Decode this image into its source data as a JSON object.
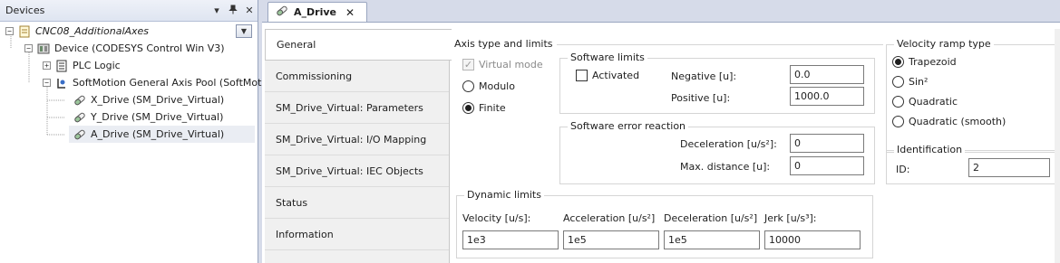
{
  "devices": {
    "title": "Devices",
    "pin_icon": "pin-icon",
    "close_label": "✕",
    "tree": [
      {
        "label": "CNC08_AdditionalAxes",
        "italic": true,
        "icon": "project-icon"
      },
      {
        "label": "Device (CODESYS Control Win V3)",
        "icon": "device-icon"
      },
      {
        "label": "PLC Logic",
        "icon": "plc-logic-icon"
      },
      {
        "label": "SoftMotion General Axis Pool (SoftMotion",
        "icon": "axis-pool-icon"
      },
      {
        "label": "X_Drive (SM_Drive_Virtual)",
        "icon": "drive-icon"
      },
      {
        "label": "Y_Drive (SM_Drive_Virtual)",
        "icon": "drive-icon"
      },
      {
        "label": "A_Drive (SM_Drive_Virtual)",
        "icon": "drive-icon"
      }
    ]
  },
  "editor": {
    "tab_label": "A_Drive",
    "tab_close": "✕",
    "side_tabs": [
      "General",
      "Commissioning",
      "SM_Drive_Virtual: Parameters",
      "SM_Drive_Virtual: I/O Mapping",
      "SM_Drive_Virtual: IEC Objects",
      "Status",
      "Information"
    ],
    "axis_type": {
      "legend": "Axis type and limits",
      "virtual_mode": "Virtual mode",
      "modulo": "Modulo",
      "finite": "Finite"
    },
    "software_limits": {
      "legend": "Software limits",
      "activated": "Activated",
      "negative_label": "Negative [u]:",
      "negative_value": "0.0",
      "positive_label": "Positive [u]:",
      "positive_value": "1000.0"
    },
    "error_reaction": {
      "legend": "Software error reaction",
      "decel_label": "Deceleration [u/s²]:",
      "decel_value": "0",
      "maxdist_label": "Max. distance [u]:",
      "maxdist_value": "0"
    },
    "dynamic_limits": {
      "legend": "Dynamic limits",
      "velocity_label": "Velocity [u/s]:",
      "velocity_value": "1e3",
      "accel_label": "Acceleration [u/s²]",
      "accel_value": "1e5",
      "decel_label": "Deceleration [u/s²]",
      "decel_value": "1e5",
      "jerk_label": "Jerk [u/s³]:",
      "jerk_value": "10000"
    },
    "ramp": {
      "legend": "Velocity ramp type",
      "options": [
        "Trapezoid",
        "Sin²",
        "Quadratic",
        "Quadratic (smooth)"
      ]
    },
    "identification": {
      "legend": "Identification",
      "id_label": "ID:",
      "id_value": "2"
    }
  }
}
